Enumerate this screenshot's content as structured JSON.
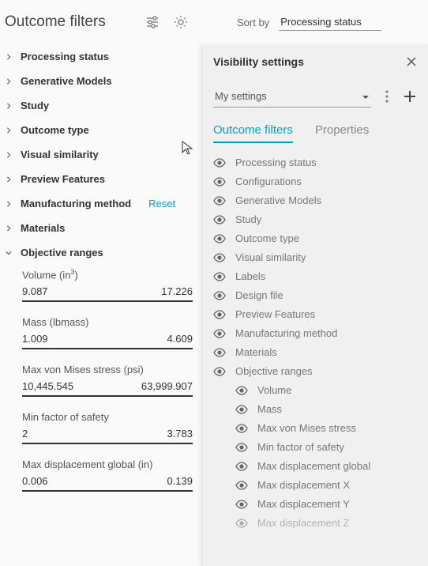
{
  "header": {
    "title": "Outcome filters"
  },
  "sort": {
    "label": "Sort by",
    "value": "Processing status"
  },
  "filters": [
    {
      "label": "Processing status"
    },
    {
      "label": "Generative Models"
    },
    {
      "label": "Study"
    },
    {
      "label": "Outcome type"
    },
    {
      "label": "Visual similarity"
    },
    {
      "label": "Preview Features"
    },
    {
      "label": "Manufacturing method",
      "reset": "Reset"
    },
    {
      "label": "Materials"
    },
    {
      "label": "Objective ranges"
    }
  ],
  "ranges": {
    "volume": {
      "label_pre": "Volume (in",
      "label_sup": "3",
      "label_post": ")",
      "min": "9.087",
      "max": "17.226"
    },
    "mass": {
      "label": "Mass (lbmass)",
      "min": "1.009",
      "max": "4.609"
    },
    "vonmises": {
      "label": "Max von Mises stress (psi)",
      "min": "10,445.545",
      "max": "63,999.907"
    },
    "safety": {
      "label": "Min factor of safety",
      "min": "2",
      "max": "3.783"
    },
    "disp": {
      "label": "Max displacement global (in)",
      "min": "0.006",
      "max": "0.139"
    }
  },
  "rightPanel": {
    "title": "Visibility settings",
    "select": "My settings",
    "tabs": {
      "active": "Outcome filters",
      "inactive": "Properties"
    },
    "items": [
      {
        "label": "Processing status"
      },
      {
        "label": "Configurations"
      },
      {
        "label": "Generative Models"
      },
      {
        "label": "Study"
      },
      {
        "label": "Outcome type"
      },
      {
        "label": "Visual similarity"
      },
      {
        "label": "Labels"
      },
      {
        "label": "Design file"
      },
      {
        "label": "Preview Features"
      },
      {
        "label": "Manufacturing method"
      },
      {
        "label": "Materials"
      },
      {
        "label": "Objective ranges"
      }
    ],
    "subitems": [
      {
        "label": "Volume"
      },
      {
        "label": "Mass"
      },
      {
        "label": "Max von Mises stress"
      },
      {
        "label": "Min factor of safety"
      },
      {
        "label": "Max displacement global"
      },
      {
        "label": "Max displacement X"
      },
      {
        "label": "Max displacement Y"
      },
      {
        "label": "Max displacement Z"
      }
    ]
  }
}
